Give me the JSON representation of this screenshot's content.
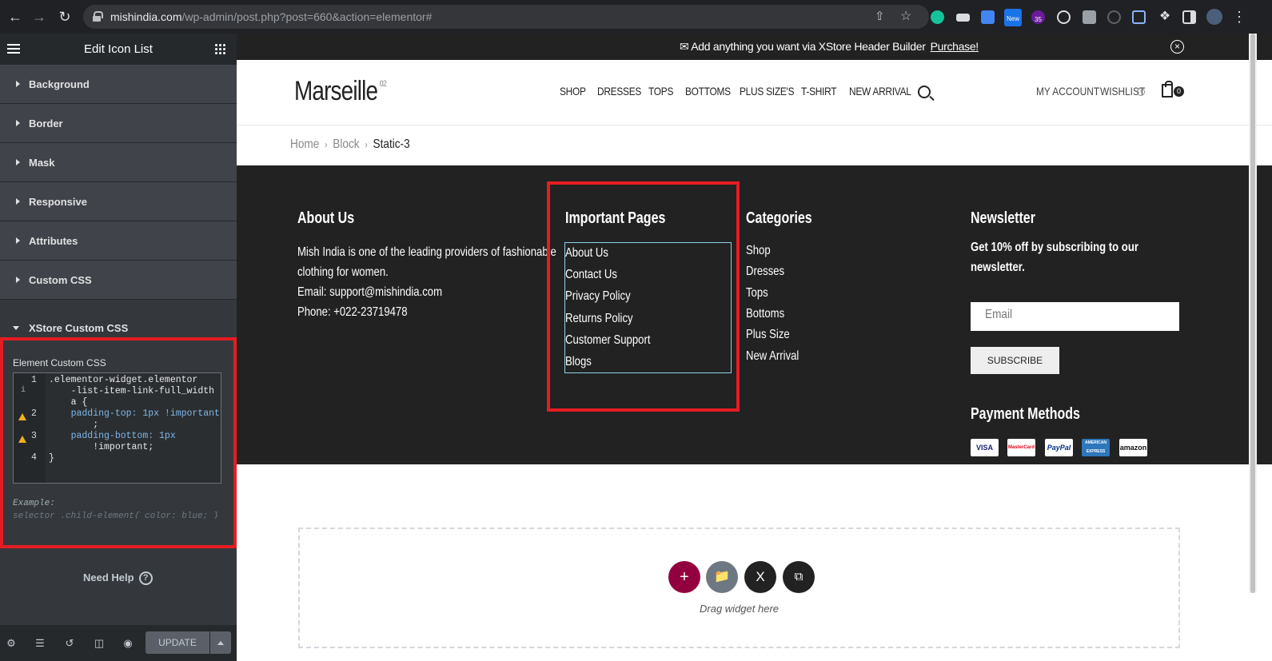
{
  "browser": {
    "url_host": "mishindia.com",
    "url_path": "/wp-admin/post.php?post=660&action=elementor#",
    "ext_badge_new": "New",
    "ext_badge_count": "35"
  },
  "panel": {
    "title": "Edit Icon List",
    "sections": [
      "Background",
      "Border",
      "Mask",
      "Responsive",
      "Attributes",
      "Custom CSS"
    ],
    "open_section": "XStore Custom CSS",
    "field_label": "Element Custom CSS",
    "code_lines": [
      ".elementor-widget.elementor",
      "    -list-item-link-full_width",
      "    a {",
      "    padding-top: 1px !important",
      "        ;",
      "    padding-bottom: 1px",
      "        !important;",
      "}"
    ],
    "line_numbers": [
      "1",
      "2",
      "3",
      "4"
    ],
    "example_label": "Example:",
    "example_code": "selector .child-element{ color: blue; }",
    "need_help": "Need Help",
    "update": "UPDATE"
  },
  "site": {
    "promo_text": "Add anything you want via XStore Header Builder",
    "promo_link": "Purchase!",
    "logo": "Marseille",
    "logo_sup": "02",
    "nav": [
      "SHOP",
      "DRESSES",
      "TOPS",
      "BOTTOMS",
      "PLUS SIZE'S",
      "T-SHIRT",
      "NEW ARRIVAL"
    ],
    "my_account": "MY ACCOUNT",
    "wishlist": "WISHLIST",
    "cart_count": "0",
    "breadcrumbs": [
      "Home",
      "Block",
      "Static-3"
    ],
    "footer": {
      "about_title": "About Us",
      "about_lines": [
        "Mish India is one of the leading providers of fashionable",
        "clothing for women.",
        "Email: support@mishindia.com",
        "Phone: +022-23719478"
      ],
      "pages_title": "Important Pages",
      "pages": [
        "About Us",
        "Contact Us",
        "Privacy Policy",
        "Returns Policy",
        "Customer Support",
        "Blogs"
      ],
      "categories_title": "Categories",
      "categories": [
        "Shop",
        "Dresses",
        "Tops",
        "Bottoms",
        "Plus Size",
        "New Arrival"
      ],
      "newsletter_title": "Newsletter",
      "newsletter_lines": [
        "Get 10% off by subscribing to our",
        "newsletter."
      ],
      "email_placeholder": "Email",
      "subscribe": "SUBSCRIBE",
      "payment_title": "Payment Methods",
      "cards": [
        "VISA",
        "MasterCard",
        "PayPal",
        "AMERICAN EXPRESS",
        "amazon"
      ]
    },
    "dropzone_text": "Drag widget here"
  },
  "colors": {
    "highlight_red": "#e51c23",
    "elementor_add": "#93003f",
    "footer_bg": "#222222"
  }
}
